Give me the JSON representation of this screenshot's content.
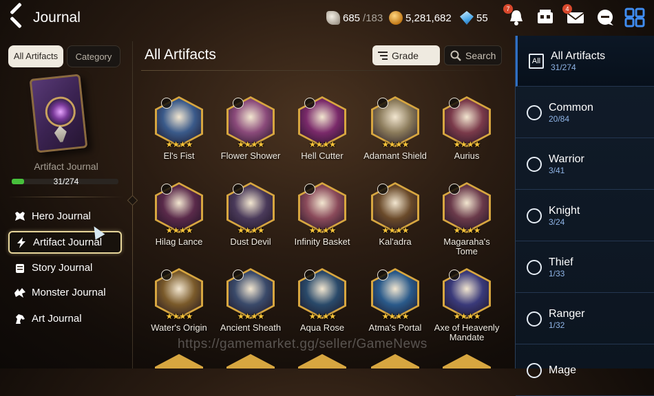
{
  "header": {
    "title": "Journal",
    "stamina": {
      "current": "685",
      "max": "/183"
    },
    "gold": "5,281,682",
    "crystals": "55",
    "notification_badge": "7",
    "mail_badge": "4"
  },
  "left_panel": {
    "tabs": [
      "All Artifacts",
      "Category"
    ],
    "journal_name": "Artifact Journal",
    "progress_text": "31/274",
    "progress_fraction": 0.113,
    "nav": [
      {
        "label": "Hero Journal",
        "icon": "hero-icon"
      },
      {
        "label": "Artifact Journal",
        "icon": "lightning-icon",
        "active": true
      },
      {
        "label": "Story Journal",
        "icon": "scroll-icon"
      },
      {
        "label": "Monster Journal",
        "icon": "dragon-icon"
      },
      {
        "label": "Art Journal",
        "icon": "horse-icon"
      }
    ]
  },
  "main": {
    "title": "All Artifacts",
    "grade_label": "Grade",
    "search_label": "Search",
    "stars": "★★★★",
    "artifacts": [
      {
        "name": "El's Fist",
        "color": "#3a5a8a"
      },
      {
        "name": "Flower Shower",
        "color": "#8a4a7a"
      },
      {
        "name": "Hell Cutter",
        "color": "#7a2a6a"
      },
      {
        "name": "Adamant Shield",
        "color": "#8a7a5a"
      },
      {
        "name": "Aurius",
        "color": "#7a3a4a"
      },
      {
        "name": "Hilag Lance",
        "color": "#5a2a4a"
      },
      {
        "name": "Dust Devil",
        "color": "#4a3a5a"
      },
      {
        "name": "Infinity Basket",
        "color": "#8a4a5a"
      },
      {
        "name": "Kal'adra",
        "color": "#6a4a2a"
      },
      {
        "name": "Magaraha's Tome",
        "color": "#6a3a4a"
      },
      {
        "name": "Water's Origin",
        "color": "#7a5a2a"
      },
      {
        "name": "Ancient Sheath",
        "color": "#3a4a6a"
      },
      {
        "name": "Aqua Rose",
        "color": "#2a4a6a"
      },
      {
        "name": "Atma's Portal",
        "color": "#2a5a8a"
      },
      {
        "name": "Axe of Heavenly Mandate",
        "color": "#3a3a7a"
      }
    ]
  },
  "watermark": "https://gamemarket.gg/seller/GameNews",
  "categories": [
    {
      "label": "All Artifacts",
      "count": "31/274",
      "icon": "all-icon",
      "icon_text": "All",
      "active": true
    },
    {
      "label": "Common",
      "count": "20/84",
      "icon": "common-icon"
    },
    {
      "label": "Warrior",
      "count": "3/41",
      "icon": "warrior-icon"
    },
    {
      "label": "Knight",
      "count": "3/24",
      "icon": "knight-icon"
    },
    {
      "label": "Thief",
      "count": "1/33",
      "icon": "thief-icon"
    },
    {
      "label": "Ranger",
      "count": "1/32",
      "icon": "ranger-icon"
    },
    {
      "label": "Mage",
      "count": "",
      "icon": "mage-icon"
    }
  ],
  "colors": {
    "accent_blue": "#2f6fc4",
    "progress_green": "#47c03c",
    "gold_border": "#d7a640",
    "star": "#f6c23a"
  }
}
